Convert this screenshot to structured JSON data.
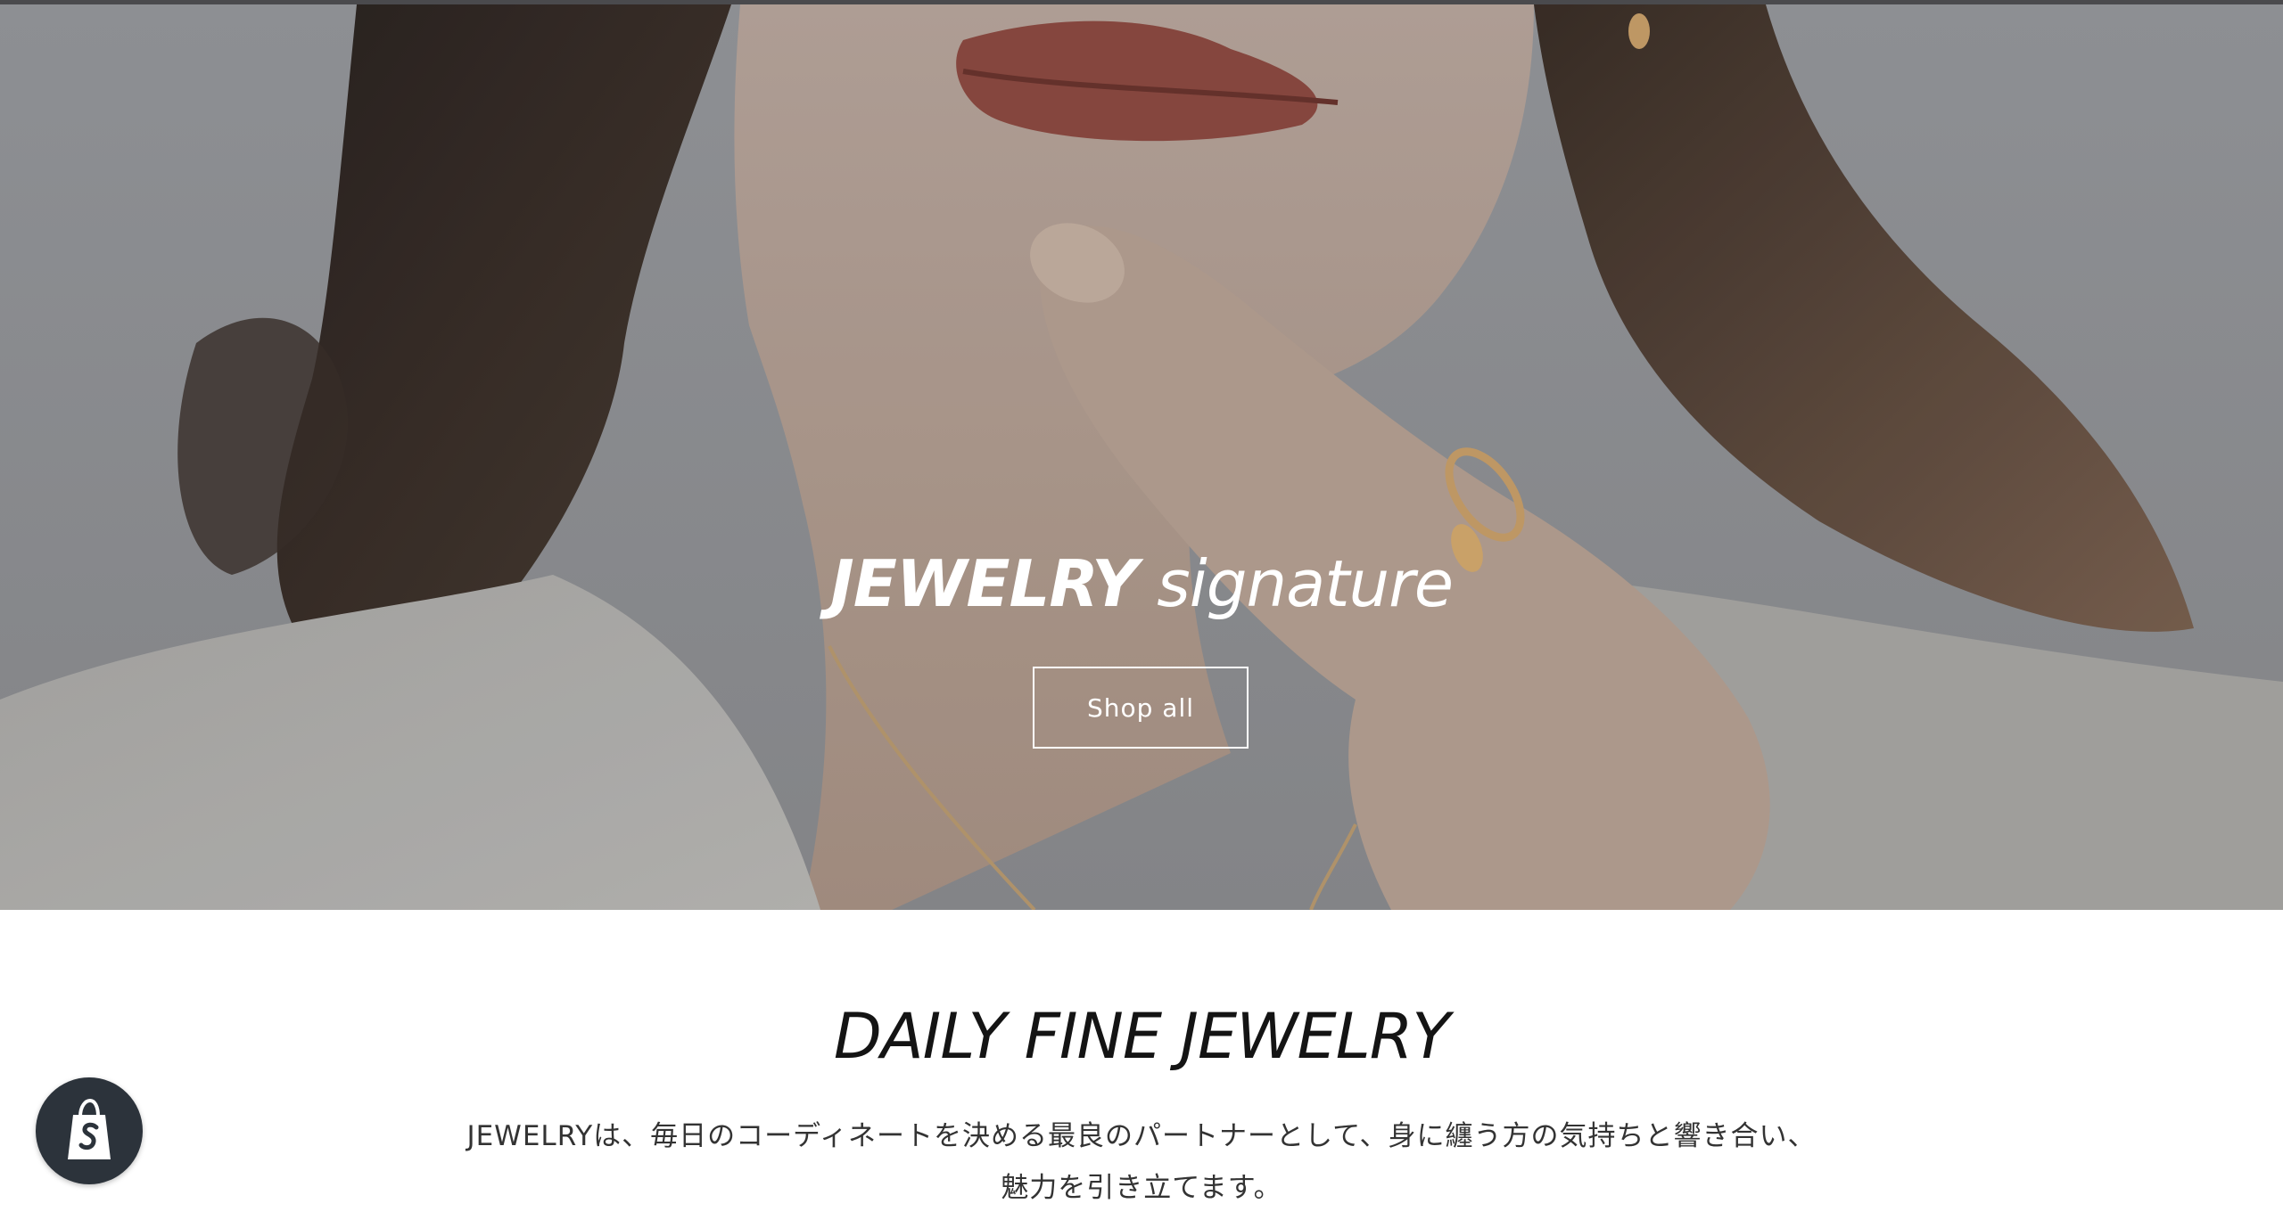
{
  "hero": {
    "title_bold": "JEWELRY",
    "title_light": "signature",
    "button_label": "Shop all"
  },
  "intro": {
    "heading": "DAILY FINE JEWELRY",
    "text_line1": "JEWELRYは、毎日のコーディネートを決める最良のパートナーとして、身に纏う方の気持ちと響き合い、",
    "text_line2": "魅力を引き立てます。"
  },
  "badge": {
    "icon": "shopify-bag-icon"
  },
  "colors": {
    "badge_bg": "#2c333b",
    "text_dark": "#141414",
    "text_body": "#333333",
    "hero_text": "#ffffff"
  }
}
